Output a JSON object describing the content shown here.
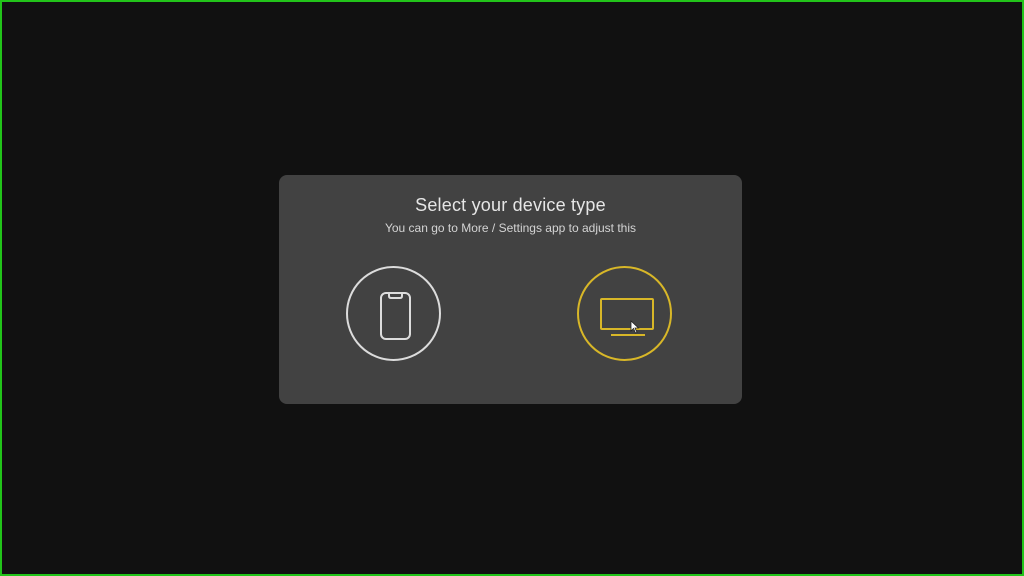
{
  "dialog": {
    "title": "Select your device type",
    "subtitle": "You can go to More / Settings app to adjust this"
  },
  "options": [
    {
      "icon": "smartphone-icon",
      "color": "#dcdcdc",
      "selected": false
    },
    {
      "icon": "tv-icon",
      "color": "#d8b728",
      "selected": true
    }
  ],
  "colors": {
    "frame_border": "#22c41a",
    "background": "#111111",
    "dialog_background": "#424242",
    "accent": "#d8b728"
  }
}
